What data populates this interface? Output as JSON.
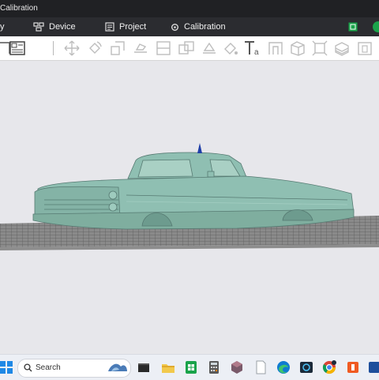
{
  "titlebar": {
    "title": "Calibration"
  },
  "menu": {
    "partial_label": "y",
    "device_label": "Device",
    "project_label": "Project",
    "calibration_label": "Calibration"
  },
  "toolbar": {
    "icons": [
      "select-region-icon",
      "layout-icon",
      "move-icon",
      "rotate-icon",
      "scale-icon",
      "lay-on-face-icon",
      "cut-icon",
      "split-parts-icon",
      "arrange-icon",
      "support-paint-icon",
      "color-paint-icon",
      "text-icon",
      "brim-ears-icon",
      "measure-icon",
      "assembly-icon",
      "variable-layer-icon",
      "plate-icon"
    ]
  },
  "taskbar": {
    "search_placeholder": "Search",
    "icons": [
      "windows-start-icon",
      "search-icon",
      "widgets-icon",
      "terminal-icon",
      "file-explorer-icon",
      "sheets-icon",
      "calculator-icon",
      "slicer-app-icon",
      "notepad-icon",
      "edge-browser-icon",
      "camera-app-icon",
      "chrome-browser-icon",
      "app-icon",
      "app-orange-icon",
      "app-blue-icon"
    ]
  },
  "colors": {
    "model": "#8fbfb2",
    "accent_green": "#1aa34a",
    "menubar_bg": "#2b2c30",
    "titlebar_bg": "#202124"
  }
}
